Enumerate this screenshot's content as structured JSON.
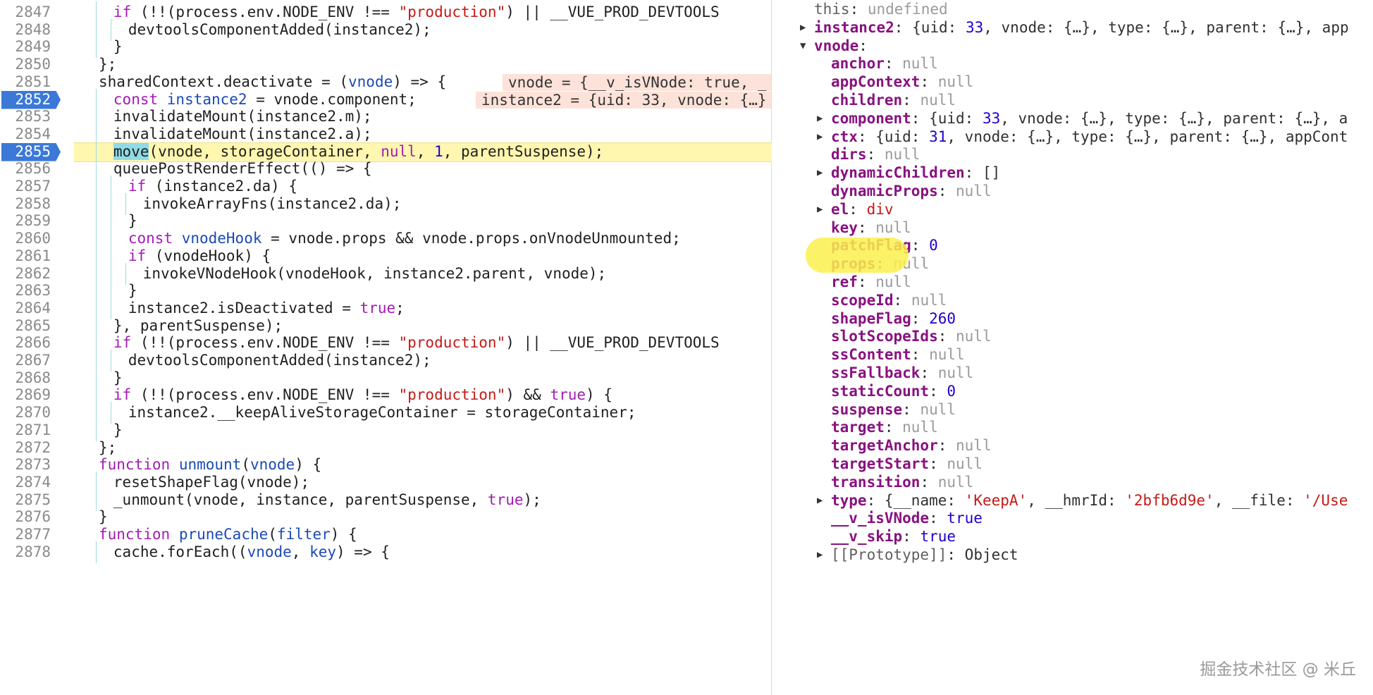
{
  "editor": {
    "lines": [
      {
        "num": "2847",
        "indent": 1,
        "code": [
          [
            "kw",
            "if"
          ],
          [
            "p",
            " (!!(process.env.NODE_ENV !== "
          ],
          [
            "str",
            "\"production\""
          ],
          [
            "p",
            ") || __VUE_PROD_DEVTOOLS"
          ]
        ]
      },
      {
        "num": "2848",
        "indent": 2,
        "code": [
          [
            "p",
            "devtoolsComponentAdded(instance2);"
          ]
        ]
      },
      {
        "num": "2849",
        "indent": 1,
        "code": [
          [
            "p",
            "}"
          ]
        ]
      },
      {
        "num": "2850",
        "indent": 0,
        "code": [
          [
            "p",
            "};"
          ]
        ]
      },
      {
        "num": "2851",
        "indent": 0,
        "code": [
          [
            "p",
            "sharedContext.deactivate = ("
          ],
          [
            "var",
            "vnode"
          ],
          [
            "p",
            ") => {"
          ]
        ],
        "inline": "vnode = {__v_isVNode: true, _"
      },
      {
        "num": "2852",
        "indent": 1,
        "bp": true,
        "code": [
          [
            "kw",
            "const"
          ],
          [
            "p",
            " "
          ],
          [
            "var",
            "instance2"
          ],
          [
            "p",
            " = vnode.component;"
          ]
        ],
        "inline": "instance2 = {uid: 33, vnode: {…}"
      },
      {
        "num": "2853",
        "indent": 1,
        "code": [
          [
            "p",
            "invalidateMount(instance2.m);"
          ]
        ]
      },
      {
        "num": "2854",
        "indent": 1,
        "code": [
          [
            "p",
            "invalidateMount(instance2.a);"
          ]
        ]
      },
      {
        "num": "2855",
        "indent": 1,
        "bp": true,
        "paused": true,
        "code": [
          [
            "hl",
            "move"
          ],
          [
            "p",
            "(vnode, storageContainer, "
          ],
          [
            "kw",
            "null"
          ],
          [
            "p",
            ", "
          ],
          [
            "num",
            "1"
          ],
          [
            "p",
            ", parentSuspense);"
          ]
        ]
      },
      {
        "num": "2856",
        "indent": 1,
        "code": [
          [
            "p",
            "queuePostRenderEffect(() => {"
          ]
        ]
      },
      {
        "num": "2857",
        "indent": 2,
        "code": [
          [
            "kw",
            "if"
          ],
          [
            "p",
            " (instance2.da) {"
          ]
        ]
      },
      {
        "num": "2858",
        "indent": 3,
        "code": [
          [
            "p",
            "invokeArrayFns(instance2.da);"
          ]
        ]
      },
      {
        "num": "2859",
        "indent": 2,
        "code": [
          [
            "p",
            "}"
          ]
        ]
      },
      {
        "num": "2860",
        "indent": 2,
        "code": [
          [
            "kw",
            "const"
          ],
          [
            "p",
            " "
          ],
          [
            "var",
            "vnodeHook"
          ],
          [
            "p",
            " = vnode.props && vnode.props.onVnodeUnmounted;"
          ]
        ]
      },
      {
        "num": "2861",
        "indent": 2,
        "code": [
          [
            "kw",
            "if"
          ],
          [
            "p",
            " (vnodeHook) {"
          ]
        ]
      },
      {
        "num": "2862",
        "indent": 3,
        "code": [
          [
            "p",
            "invokeVNodeHook(vnodeHook, instance2.parent, vnode);"
          ]
        ]
      },
      {
        "num": "2863",
        "indent": 2,
        "code": [
          [
            "p",
            "}"
          ]
        ]
      },
      {
        "num": "2864",
        "indent": 2,
        "code": [
          [
            "p",
            "instance2.isDeactivated = "
          ],
          [
            "kw",
            "true"
          ],
          [
            "p",
            ";"
          ]
        ]
      },
      {
        "num": "2865",
        "indent": 1,
        "code": [
          [
            "p",
            "}, parentSuspense);"
          ]
        ]
      },
      {
        "num": "2866",
        "indent": 1,
        "code": [
          [
            "kw",
            "if"
          ],
          [
            "p",
            " (!!(process.env.NODE_ENV !== "
          ],
          [
            "str",
            "\"production\""
          ],
          [
            "p",
            ") || __VUE_PROD_DEVTOOLS"
          ]
        ]
      },
      {
        "num": "2867",
        "indent": 2,
        "code": [
          [
            "p",
            "devtoolsComponentAdded(instance2);"
          ]
        ]
      },
      {
        "num": "2868",
        "indent": 1,
        "code": [
          [
            "p",
            "}"
          ]
        ]
      },
      {
        "num": "2869",
        "indent": 1,
        "code": [
          [
            "kw",
            "if"
          ],
          [
            "p",
            " (!!(process.env.NODE_ENV !== "
          ],
          [
            "str",
            "\"production\""
          ],
          [
            "p",
            ") && "
          ],
          [
            "kw",
            "true"
          ],
          [
            "p",
            ") {"
          ]
        ]
      },
      {
        "num": "2870",
        "indent": 2,
        "code": [
          [
            "p",
            "instance2.__keepAliveStorageContainer = storageContainer;"
          ]
        ]
      },
      {
        "num": "2871",
        "indent": 1,
        "code": [
          [
            "p",
            "}"
          ]
        ]
      },
      {
        "num": "2872",
        "indent": 0,
        "code": [
          [
            "p",
            "};"
          ]
        ]
      },
      {
        "num": "2873",
        "indent": 0,
        "code": [
          [
            "kw",
            "function"
          ],
          [
            "p",
            " "
          ],
          [
            "fn",
            "unmount"
          ],
          [
            "p",
            "("
          ],
          [
            "var",
            "vnode"
          ],
          [
            "p",
            ") {"
          ]
        ]
      },
      {
        "num": "2874",
        "indent": 1,
        "code": [
          [
            "p",
            "resetShapeFlag(vnode);"
          ]
        ]
      },
      {
        "num": "2875",
        "indent": 1,
        "code": [
          [
            "p",
            "_unmount(vnode, instance, parentSuspense, "
          ],
          [
            "kw",
            "true"
          ],
          [
            "p",
            ");"
          ]
        ]
      },
      {
        "num": "2876",
        "indent": 0,
        "code": [
          [
            "p",
            "}"
          ]
        ]
      },
      {
        "num": "2877",
        "indent": 0,
        "code": [
          [
            "kw",
            "function"
          ],
          [
            "p",
            " "
          ],
          [
            "fn",
            "pruneCache"
          ],
          [
            "p",
            "("
          ],
          [
            "var",
            "filter"
          ],
          [
            "p",
            ") {"
          ]
        ]
      },
      {
        "num": "2878",
        "indent": 1,
        "code": [
          [
            "p",
            "cache.forEach(("
          ],
          [
            "var",
            "vnode"
          ],
          [
            "p",
            ", "
          ],
          [
            "var",
            "key"
          ],
          [
            "p",
            ") => {"
          ]
        ]
      }
    ]
  },
  "scope": {
    "rows": [
      {
        "level": 0,
        "key": "this",
        "plain": true,
        "vals": [
          [
            "undef",
            "undefined"
          ]
        ]
      },
      {
        "level": 0,
        "key": "instance2",
        "tri": "right",
        "vals": [
          [
            "obj",
            "{uid: "
          ],
          [
            "num",
            "33"
          ],
          [
            "obj",
            ", vnode: {…}, type: {…}, parent: {…}, app"
          ]
        ]
      },
      {
        "level": 0,
        "key": "vnode",
        "tri": "down",
        "vals": []
      },
      {
        "level": 1,
        "key": "anchor",
        "vals": [
          [
            "null",
            "null"
          ]
        ]
      },
      {
        "level": 1,
        "key": "appContext",
        "vals": [
          [
            "null",
            "null"
          ]
        ]
      },
      {
        "level": 1,
        "key": "children",
        "vals": [
          [
            "null",
            "null"
          ]
        ]
      },
      {
        "level": 1,
        "key": "component",
        "tri": "right",
        "vals": [
          [
            "obj",
            "{uid: "
          ],
          [
            "num",
            "33"
          ],
          [
            "obj",
            ", vnode: {…}, type: {…}, parent: {…}, a"
          ]
        ]
      },
      {
        "level": 1,
        "key": "ctx",
        "tri": "right",
        "vals": [
          [
            "obj",
            "{uid: "
          ],
          [
            "num",
            "31"
          ],
          [
            "obj",
            ", vnode: {…}, type: {…}, parent: {…}, appCont"
          ]
        ]
      },
      {
        "level": 1,
        "key": "dirs",
        "vals": [
          [
            "null",
            "null"
          ]
        ]
      },
      {
        "level": 1,
        "key": "dynamicChildren",
        "tri": "right",
        "vals": [
          [
            "obj",
            "[]"
          ]
        ]
      },
      {
        "level": 1,
        "key": "dynamicProps",
        "vals": [
          [
            "null",
            "null"
          ]
        ]
      },
      {
        "level": 1,
        "key": "el",
        "tri": "right",
        "vals": [
          [
            "str",
            "div"
          ]
        ]
      },
      {
        "level": 1,
        "key": "key",
        "vals": [
          [
            "null",
            "null"
          ]
        ]
      },
      {
        "level": 1,
        "key": "patchFlag",
        "vals": [
          [
            "num",
            "0"
          ]
        ]
      },
      {
        "level": 1,
        "key": "props",
        "vals": [
          [
            "null",
            "null"
          ]
        ]
      },
      {
        "level": 1,
        "key": "ref",
        "vals": [
          [
            "null",
            "null"
          ]
        ]
      },
      {
        "level": 1,
        "key": "scopeId",
        "vals": [
          [
            "null",
            "null"
          ]
        ]
      },
      {
        "level": 1,
        "key": "shapeFlag",
        "vals": [
          [
            "num",
            "260"
          ]
        ]
      },
      {
        "level": 1,
        "key": "slotScopeIds",
        "vals": [
          [
            "null",
            "null"
          ]
        ]
      },
      {
        "level": 1,
        "key": "ssContent",
        "vals": [
          [
            "null",
            "null"
          ]
        ]
      },
      {
        "level": 1,
        "key": "ssFallback",
        "vals": [
          [
            "null",
            "null"
          ]
        ]
      },
      {
        "level": 1,
        "key": "staticCount",
        "vals": [
          [
            "num",
            "0"
          ]
        ]
      },
      {
        "level": 1,
        "key": "suspense",
        "vals": [
          [
            "null",
            "null"
          ]
        ]
      },
      {
        "level": 1,
        "key": "target",
        "vals": [
          [
            "null",
            "null"
          ]
        ]
      },
      {
        "level": 1,
        "key": "targetAnchor",
        "vals": [
          [
            "null",
            "null"
          ]
        ]
      },
      {
        "level": 1,
        "key": "targetStart",
        "vals": [
          [
            "null",
            "null"
          ]
        ]
      },
      {
        "level": 1,
        "key": "transition",
        "vals": [
          [
            "null",
            "null"
          ]
        ]
      },
      {
        "level": 1,
        "key": "type",
        "tri": "right",
        "vals": [
          [
            "obj",
            "{__name: "
          ],
          [
            "str",
            "'KeepA'"
          ],
          [
            "obj",
            ", __hmrId: "
          ],
          [
            "str",
            "'2bfb6d9e'"
          ],
          [
            "obj",
            ", __file: "
          ],
          [
            "str",
            "'/Use"
          ]
        ]
      },
      {
        "level": 1,
        "key": "__v_isVNode",
        "vals": [
          [
            "bool",
            "true"
          ]
        ]
      },
      {
        "level": 1,
        "key": "__v_skip",
        "vals": [
          [
            "bool",
            "true"
          ]
        ]
      },
      {
        "level": 1,
        "key": "[[Prototype]]",
        "plain": true,
        "tri": "right",
        "vals": [
          [
            "obj",
            "Object"
          ]
        ]
      }
    ]
  },
  "watermark": "掘金技术社区 @ 米丘"
}
